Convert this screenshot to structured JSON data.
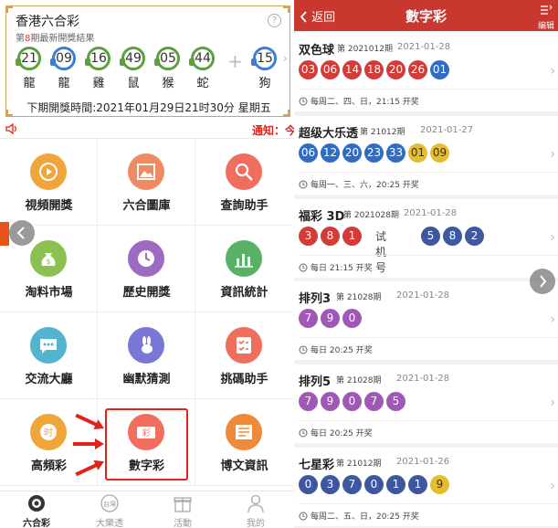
{
  "left": {
    "card": {
      "title": "香港六合彩",
      "subtitle_pre": "第",
      "subtitle_num": "8",
      "subtitle_post": "期最新開獎結果",
      "help_icon": "?",
      "balls": [
        {
          "num": "21",
          "zodiac": "龍",
          "color": "green"
        },
        {
          "num": "09",
          "zodiac": "龍",
          "color": "blue"
        },
        {
          "num": "16",
          "zodiac": "雞",
          "color": "green"
        },
        {
          "num": "49",
          "zodiac": "鼠",
          "color": "green"
        },
        {
          "num": "05",
          "zodiac": "猴",
          "color": "green"
        },
        {
          "num": "44",
          "zodiac": "蛇",
          "color": "green"
        }
      ],
      "special": {
        "num": "15",
        "zodiac": "狗",
        "color": "blue"
      },
      "plus": "+",
      "chevron": "›",
      "next_draw": "下期開獎時間:2021年01月29日21时30分 星期五"
    },
    "notice": "通知：今",
    "grid": [
      {
        "label": "視頻開獎",
        "icon": "video-play-icon",
        "color": "#f0a53a"
      },
      {
        "label": "六合圖庫",
        "icon": "picture-icon",
        "color": "#ef8a62"
      },
      {
        "label": "查詢助手",
        "icon": "magnifier-icon",
        "color": "#ef6e5e"
      },
      {
        "label": "淘料市場",
        "icon": "money-bag-icon",
        "color": "#8cc152"
      },
      {
        "label": "歷史開獎",
        "icon": "clock-icon",
        "color": "#9d6bc1"
      },
      {
        "label": "資訊統計",
        "icon": "bar-chart-icon",
        "color": "#58b165"
      },
      {
        "label": "交流大廳",
        "icon": "chat-bubble-icon",
        "color": "#52b4cf"
      },
      {
        "label": "幽默猜測",
        "icon": "rabbit-icon",
        "color": "#7b77d8"
      },
      {
        "label": "挑碼助手",
        "icon": "checklist-icon",
        "color": "#ef6e5e"
      },
      {
        "label": "高頻彩",
        "icon": "clock-ball-icon",
        "color": "#f0a53a"
      },
      {
        "label": "數字彩",
        "icon": "ticket-icon",
        "color": "#ef6e5e"
      },
      {
        "label": "博文資訊",
        "icon": "newspaper-icon",
        "color": "#ef8a3a"
      }
    ],
    "tabs": [
      {
        "label": "六合彩",
        "icon": "lottery-ball-icon",
        "active": true
      },
      {
        "label": "大樂透",
        "icon": "taiwan-badge-icon",
        "active": false
      },
      {
        "label": "活動",
        "icon": "gift-icon",
        "active": false
      },
      {
        "label": "我的",
        "icon": "person-icon",
        "active": false
      }
    ],
    "tab_badge_text": "台灣"
  },
  "right": {
    "back_label": "返回",
    "title": "數字彩",
    "edit_label": "编辑",
    "trial_label": "试机号",
    "sections": [
      {
        "name": "双色球",
        "issue": "第 2021012期",
        "date": "2021-01-28",
        "balls": [
          {
            "n": "03",
            "c": "red"
          },
          {
            "n": "06",
            "c": "red"
          },
          {
            "n": "14",
            "c": "red"
          },
          {
            "n": "18",
            "c": "red"
          },
          {
            "n": "20",
            "c": "red"
          },
          {
            "n": "26",
            "c": "red"
          },
          {
            "n": "01",
            "c": "blue"
          }
        ],
        "schedule": "每周二、四、日，21:15 开奖"
      },
      {
        "name": "超级大乐透",
        "issue": "第 21012期",
        "date": "2021-01-27",
        "balls": [
          {
            "n": "06",
            "c": "blue"
          },
          {
            "n": "12",
            "c": "blue"
          },
          {
            "n": "20",
            "c": "blue"
          },
          {
            "n": "23",
            "c": "blue"
          },
          {
            "n": "33",
            "c": "blue"
          },
          {
            "n": "01",
            "c": "yellow"
          },
          {
            "n": "09",
            "c": "yellow"
          }
        ],
        "schedule": "每周一、三、六，20:25 开奖"
      },
      {
        "name": "福彩 3D",
        "issue": "第 2021028期",
        "date": "2021-01-28",
        "balls": [
          {
            "n": "3",
            "c": "red"
          },
          {
            "n": "8",
            "c": "red"
          },
          {
            "n": "1",
            "c": "red"
          }
        ],
        "trial": [
          {
            "n": "5",
            "c": "navy"
          },
          {
            "n": "8",
            "c": "navy"
          },
          {
            "n": "2",
            "c": "navy"
          }
        ],
        "schedule": "每日 21:15 开奖"
      },
      {
        "name": "排列3",
        "issue": "第 21028期",
        "date": "2021-01-28",
        "balls": [
          {
            "n": "7",
            "c": "purple"
          },
          {
            "n": "9",
            "c": "purple"
          },
          {
            "n": "0",
            "c": "purple"
          }
        ],
        "schedule": "每日 20:25 开奖"
      },
      {
        "name": "排列5",
        "issue": "第 21028期",
        "date": "2021-01-28",
        "balls": [
          {
            "n": "7",
            "c": "purple"
          },
          {
            "n": "9",
            "c": "purple"
          },
          {
            "n": "0",
            "c": "purple"
          },
          {
            "n": "7",
            "c": "purple"
          },
          {
            "n": "5",
            "c": "purple"
          }
        ],
        "schedule": "每日 20:25 开奖"
      },
      {
        "name": "七星彩",
        "issue": "第 21012期",
        "date": "2021-01-26",
        "balls": [
          {
            "n": "0",
            "c": "navy"
          },
          {
            "n": "3",
            "c": "navy"
          },
          {
            "n": "7",
            "c": "navy"
          },
          {
            "n": "0",
            "c": "navy"
          },
          {
            "n": "1",
            "c": "navy"
          },
          {
            "n": "1",
            "c": "navy"
          },
          {
            "n": "9",
            "c": "yellow"
          }
        ],
        "schedule": "每周二、五、日，20:25 开奖"
      }
    ]
  }
}
